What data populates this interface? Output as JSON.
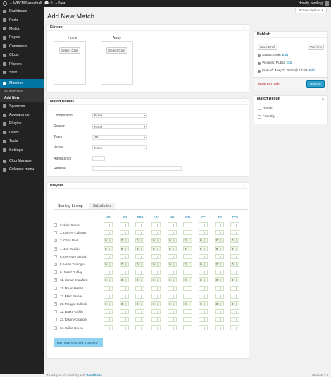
{
  "topbar": {
    "site": "WPCM Basketball",
    "comments": "0",
    "new": "New",
    "howdy": "Howdy, rooi6og"
  },
  "sidebar": {
    "items": [
      {
        "label": "Dashboard",
        "icon": "dashboard-icon"
      },
      {
        "label": "Posts",
        "icon": "pin-icon"
      },
      {
        "label": "Media",
        "icon": "media-icon"
      },
      {
        "label": "Pages",
        "icon": "page-icon"
      },
      {
        "label": "Comments",
        "icon": "comment-icon"
      },
      {
        "label": "Clubs",
        "icon": "shield-icon"
      },
      {
        "label": "Players",
        "icon": "players-icon"
      },
      {
        "label": "Staff",
        "icon": "staff-icon"
      },
      {
        "label": "Matches",
        "icon": "calendar-icon"
      }
    ],
    "submenu": [
      "All Matches",
      "Add New"
    ],
    "items2": [
      {
        "label": "Sponsors",
        "icon": "megaphone-icon"
      },
      {
        "label": "Appearance",
        "icon": "brush-icon"
      },
      {
        "label": "Plugins",
        "icon": "plug-icon"
      },
      {
        "label": "Users",
        "icon": "users-icon"
      },
      {
        "label": "Tools",
        "icon": "wrench-icon"
      },
      {
        "label": "Settings",
        "icon": "sliders-icon"
      },
      {
        "label": "Club Manager",
        "icon": "trophy-icon"
      },
      {
        "label": "Collapse menu",
        "icon": "collapse-icon"
      }
    ]
  },
  "page": {
    "title": "Add New Match",
    "screen_options": "Screen Options ▾"
  },
  "fixture": {
    "title": "Fixture",
    "home": "Home",
    "away": "Away",
    "select_club": "Select Club"
  },
  "details": {
    "title": "Match Details",
    "competition_label": "Competition",
    "competition": "None",
    "season_label": "Season",
    "season": "None",
    "team_label": "Team",
    "team": "All",
    "venue_label": "Venue",
    "venue": "None",
    "attendance_label": "Attendance",
    "referee_label": "Referee"
  },
  "publish": {
    "title": "Publish",
    "save_draft": "Save Draft",
    "preview": "Preview",
    "status": "Status: Draft",
    "visibility": "Visibility: Public",
    "kickoff": "Kick-off: May 7, 2014 @ 14:33",
    "edit": "Edit",
    "trash": "Move to Trash",
    "publish": "Publish"
  },
  "result": {
    "title": "Match Result",
    "opt1": "Result",
    "opt2": "Friendly"
  },
  "players": {
    "title": "Players",
    "tab1": "Starting Lineup",
    "tab2": "Substitutes",
    "columns": [
      "MIN",
      "OR",
      "REB",
      "AST",
      "BLK",
      "STL",
      "PF",
      "TO",
      "PTS"
    ],
    "rows": [
      {
        "name": "0. Glen Davis",
        "checked": false
      },
      {
        "name": "2. Darren Collison",
        "checked": false
      },
      {
        "name": "3. Chris Paul",
        "checked": true
      },
      {
        "name": "4. J.J. Redick",
        "checked": true
      },
      {
        "name": "6. DeAndre Jordan",
        "checked": false
      },
      {
        "name": "8. Hedo Turkoglu",
        "checked": true
      },
      {
        "name": "9. Jared Dudley",
        "checked": false
      },
      {
        "name": "11. Jamal Crawford",
        "checked": true
      },
      {
        "name": "15. Ryan Hollins",
        "checked": false
      },
      {
        "name": "22. Matt Barnes",
        "checked": false
      },
      {
        "name": "25. Reggie Bullock",
        "checked": true
      },
      {
        "name": "32. Blake Griffin",
        "checked": false
      },
      {
        "name": "33. Danny Granger",
        "checked": false
      },
      {
        "name": "34. Willie Green",
        "checked": false
      }
    ],
    "zero": "0",
    "selected_note": "You have selected 5 players"
  },
  "footer": {
    "left_prefix": "Thank you for creating with ",
    "left_link": "WordPress",
    "version": "Version 3.9"
  }
}
